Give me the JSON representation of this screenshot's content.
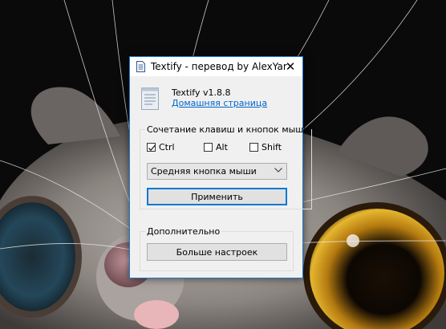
{
  "window": {
    "title": "Textify - перевод by AlexYar",
    "close_glyph": "✕",
    "accent": "#1b78d4"
  },
  "about": {
    "version": "Textify v1.8.8",
    "homepage_link": "Домашняя страница"
  },
  "hotkey_group": {
    "legend": "Сочетание клавиш и кнопок мыши",
    "checkboxes": [
      {
        "label": "Ctrl",
        "checked": true
      },
      {
        "label": "Alt",
        "checked": false
      },
      {
        "label": "Shift",
        "checked": false
      }
    ],
    "mouse_button_select": "Средняя кнопка мыши",
    "apply_button": "Применить"
  },
  "extra_group": {
    "legend": "Дополнительно",
    "more_settings_button": "Больше настроек"
  },
  "icons": [
    "textify-app-icon",
    "close-icon",
    "document-icon",
    "checkmark-icon",
    "chevron-down-icon"
  ]
}
